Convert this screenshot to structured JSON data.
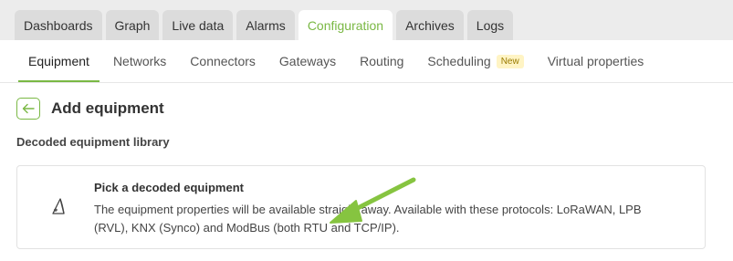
{
  "main_tabs": [
    {
      "label": "Dashboards",
      "active": false
    },
    {
      "label": "Graph",
      "active": false
    },
    {
      "label": "Live data",
      "active": false
    },
    {
      "label": "Alarms",
      "active": false
    },
    {
      "label": "Configuration",
      "active": true
    },
    {
      "label": "Archives",
      "active": false
    },
    {
      "label": "Logs",
      "active": false
    }
  ],
  "sub_tabs": [
    {
      "label": "Equipment",
      "active": true
    },
    {
      "label": "Networks",
      "active": false
    },
    {
      "label": "Connectors",
      "active": false
    },
    {
      "label": "Gateways",
      "active": false
    },
    {
      "label": "Routing",
      "active": false
    },
    {
      "label": "Scheduling",
      "active": false,
      "badge": "New"
    },
    {
      "label": "Virtual properties",
      "active": false
    }
  ],
  "page": {
    "back_icon": "arrow-left-icon",
    "title": "Add equipment",
    "section_title": "Decoded equipment library"
  },
  "card": {
    "icon": "sail-icon",
    "title": "Pick a decoded equipment",
    "description": "The equipment properties will be available straight away. Available with these protocols: LoRaWAN, LPB (RVL), KNX (Synco) and ModBus (both RTU and TCP/IP)."
  },
  "colors": {
    "accent": "#7ab844",
    "annotation_arrow": "#86c440",
    "badge_bg": "#fff4c4",
    "badge_text": "#9a7b00"
  }
}
